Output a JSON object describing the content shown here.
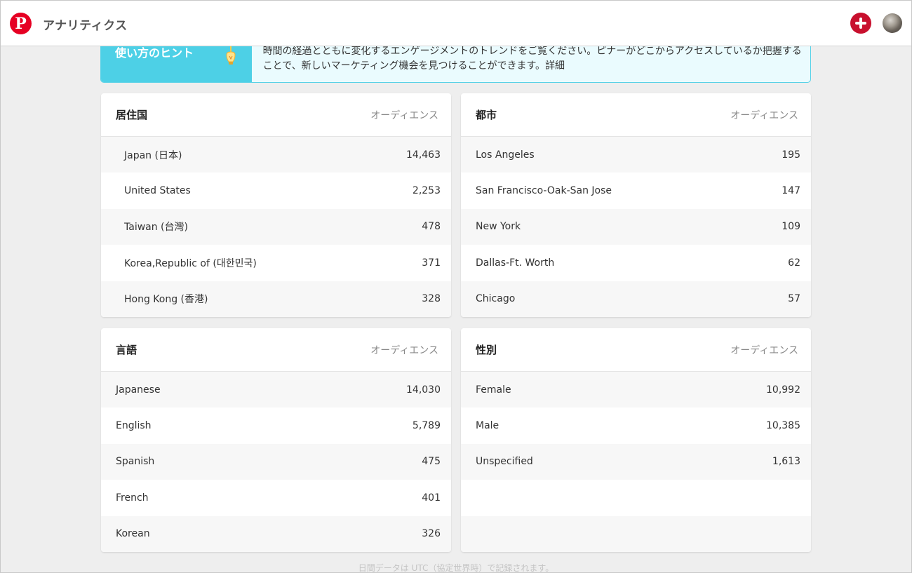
{
  "app": {
    "title": "アナリティクス",
    "logo_letter": "P"
  },
  "tip": {
    "heading": "使い方のヒント",
    "text": "時間の経過とともに変化するエンゲージメントのトレンドをご覧ください。ピナーがどこからアクセスしているか把握することで、新しいマーケティング機会を見つけることができます。",
    "link": "詳細"
  },
  "cards": {
    "country": {
      "title": "居住国",
      "subtitle": "オーディエンス",
      "rows": [
        {
          "label": "Japan (日本)",
          "value": "14,463"
        },
        {
          "label": "United States",
          "value": "2,253"
        },
        {
          "label": "Taiwan (台灣)",
          "value": "478"
        },
        {
          "label": "Korea,Republic of (대한민국)",
          "value": "371"
        },
        {
          "label": "Hong Kong (香港)",
          "value": "328"
        }
      ]
    },
    "city": {
      "title": "都市",
      "subtitle": "オーディエンス",
      "rows": [
        {
          "label": "Los Angeles",
          "value": "195"
        },
        {
          "label": "San Francisco-Oak-San Jose",
          "value": "147"
        },
        {
          "label": "New York",
          "value": "109"
        },
        {
          "label": "Dallas-Ft. Worth",
          "value": "62"
        },
        {
          "label": "Chicago",
          "value": "57"
        }
      ]
    },
    "language": {
      "title": "言語",
      "subtitle": "オーディエンス",
      "rows": [
        {
          "label": "Japanese",
          "value": "14,030"
        },
        {
          "label": "English",
          "value": "5,789"
        },
        {
          "label": "Spanish",
          "value": "475"
        },
        {
          "label": "French",
          "value": "401"
        },
        {
          "label": "Korean",
          "value": "326"
        }
      ]
    },
    "gender": {
      "title": "性別",
      "subtitle": "オーディエンス",
      "rows": [
        {
          "label": "Female",
          "value": "10,992"
        },
        {
          "label": "Male",
          "value": "10,385"
        },
        {
          "label": "Unspecified",
          "value": "1,613"
        },
        {
          "label": "",
          "value": ""
        },
        {
          "label": "",
          "value": ""
        }
      ]
    }
  },
  "footer": {
    "note": "日間データは UTC（協定世界時）で記録されます。"
  },
  "colors": {
    "brand": "#e60023",
    "tip_accent": "#4dd0e6",
    "tip_bg": "#eafbfe"
  },
  "icons": {
    "logo": "pinterest-logo-icon",
    "add": "plus-circle-icon",
    "bulb": "lightbulb-icon"
  }
}
